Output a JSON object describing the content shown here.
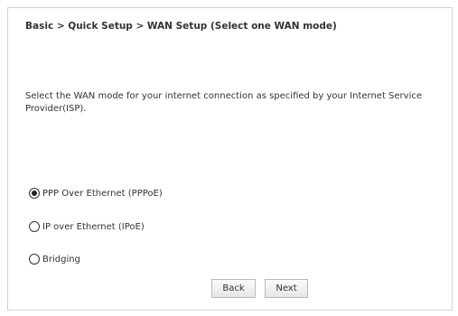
{
  "header": {
    "breadcrumb": "Basic > Quick Setup > WAN Setup (Select one WAN mode)"
  },
  "main": {
    "description": "Select the WAN mode for your internet connection as specified by your Internet Service Provider(ISP).",
    "wan_modes": [
      {
        "label": "PPP Over Ethernet (PPPoE)",
        "selected": true
      },
      {
        "label": "IP over Ethernet (IPoE)",
        "selected": false
      },
      {
        "label": "Bridging",
        "selected": false
      }
    ]
  },
  "buttons": {
    "back_label": "Back",
    "next_label": "Next"
  }
}
